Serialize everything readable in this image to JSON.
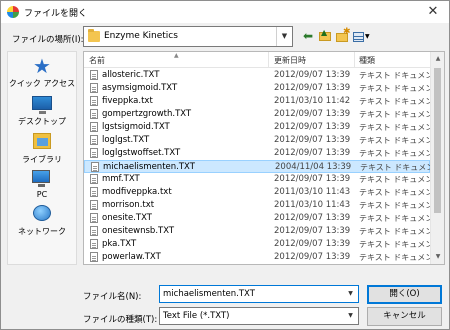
{
  "window": {
    "title": "ファイルを開く"
  },
  "lookin": {
    "label": "ファイルの場所(I):",
    "value": "Enzyme Kinetics"
  },
  "sidebar": {
    "items": [
      {
        "label": "クイック アクセス",
        "icon": "star-icon"
      },
      {
        "label": "デスクトップ",
        "icon": "desktop-icon"
      },
      {
        "label": "ライブラリ",
        "icon": "library-icon"
      },
      {
        "label": "PC",
        "icon": "computer-icon"
      },
      {
        "label": "ネットワーク",
        "icon": "network-icon"
      }
    ]
  },
  "columns": {
    "name": "名前",
    "date": "更新日時",
    "type": "種類"
  },
  "files": [
    {
      "name": "allosteric.TXT",
      "date": "2012/09/07 13:39",
      "type": "テキスト ドキュメント"
    },
    {
      "name": "asymsigmoid.TXT",
      "date": "2012/09/07 13:39",
      "type": "テキスト ドキュメント"
    },
    {
      "name": "fiveppka.txt",
      "date": "2011/03/10 11:42",
      "type": "テキスト ドキュメント"
    },
    {
      "name": "gompertzgrowth.TXT",
      "date": "2012/09/07 13:39",
      "type": "テキスト ドキュメント"
    },
    {
      "name": "lgstsigmoid.TXT",
      "date": "2012/09/07 13:39",
      "type": "テキスト ドキュメント"
    },
    {
      "name": "loglgst.TXT",
      "date": "2012/09/07 13:39",
      "type": "テキスト ドキュメント"
    },
    {
      "name": "loglgstwoffset.TXT",
      "date": "2012/09/07 13:39",
      "type": "テキスト ドキュメント"
    },
    {
      "name": "michaelismenten.TXT",
      "date": "2004/11/04 13:39",
      "type": "テキスト ドキュメント",
      "selected": true
    },
    {
      "name": "mmf.TXT",
      "date": "2012/09/07 13:39",
      "type": "テキスト ドキュメント"
    },
    {
      "name": "modfiveppka.txt",
      "date": "2011/03/10 11:43",
      "type": "テキスト ドキュメント"
    },
    {
      "name": "morrison.txt",
      "date": "2011/03/10 11:43",
      "type": "テキスト ドキュメント"
    },
    {
      "name": "onesite.TXT",
      "date": "2012/09/07 13:39",
      "type": "テキスト ドキュメント"
    },
    {
      "name": "onesitewnsb.TXT",
      "date": "2012/09/07 13:39",
      "type": "テキスト ドキュメント"
    },
    {
      "name": "pka.TXT",
      "date": "2012/09/07 13:39",
      "type": "テキスト ドキュメント"
    },
    {
      "name": "powerlaw.TXT",
      "date": "2012/09/07 13:39",
      "type": "テキスト ドキュメント"
    }
  ],
  "filename": {
    "label": "ファイル名(N):",
    "value": "michaelismenten.TXT"
  },
  "filetype": {
    "label": "ファイルの種類(T):",
    "value": "Text File (*.TXT)"
  },
  "buttons": {
    "open": "開く(O)",
    "cancel": "キャンセル"
  },
  "colors": {
    "selection": "#cce8ff",
    "accent": "#0078d7"
  }
}
